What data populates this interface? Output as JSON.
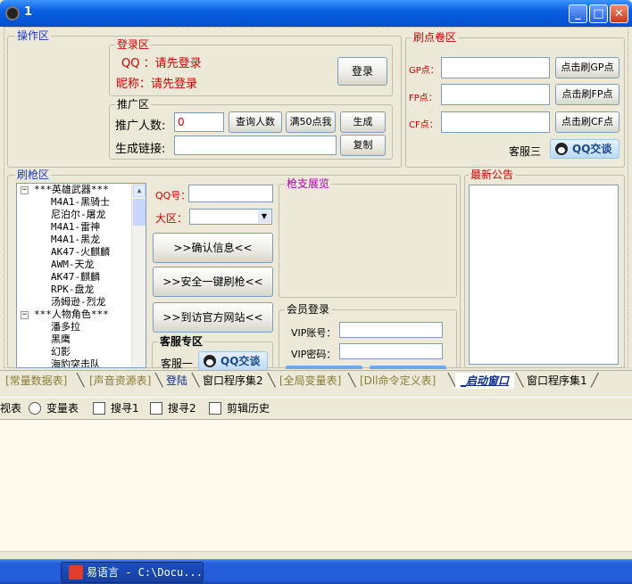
{
  "window": {
    "title": "1"
  },
  "ops": {
    "legend": "操作区"
  },
  "login": {
    "legend": "登录区",
    "qq_label": "QQ ：请先登录",
    "nick_label": "昵称：请先登录",
    "login_btn": "登录"
  },
  "promo": {
    "legend": "推广区",
    "count_label": "推广人数:",
    "count_value": "0",
    "query_btn": "查询人数",
    "full50_btn": "满50点我",
    "generate_btn": "生成",
    "link_label": "生成链接:",
    "link_value": "",
    "copy_btn": "复制"
  },
  "points": {
    "legend": "刷点卷区",
    "gp_label": "GP点：",
    "fp_label": "FP点：",
    "cf_label": "CF点：",
    "gp_btn": "点击刷GP点",
    "fp_btn": "点击刷FP点",
    "cf_btn": "点击刷CF点",
    "service_label": "客服三",
    "qq_btn": "QQ交谈"
  },
  "guns": {
    "legend": "刷枪区",
    "qq_label": "QQ号：",
    "qq_value": "",
    "region_label": "大区：",
    "region_value": "",
    "confirm_btn": ">>确认信息<<",
    "safe_btn": ">>安全一键刷枪<<",
    "official_btn": ">>到访官方网站<<",
    "service_legend": "客服专区",
    "service_label": "客服一",
    "qq_btn": "QQ交谈"
  },
  "tree": {
    "items": [
      {
        "type": "root",
        "label": "***英雄武器***"
      },
      {
        "type": "leaf",
        "label": "M4A1-黑骑士"
      },
      {
        "type": "leaf",
        "label": "尼泊尔-屠龙"
      },
      {
        "type": "leaf",
        "label": "M4A1-雷神"
      },
      {
        "type": "leaf",
        "label": "M4A1-黑龙"
      },
      {
        "type": "leaf",
        "label": "AK47-火麒麟"
      },
      {
        "type": "leaf",
        "label": "AWM-天龙"
      },
      {
        "type": "leaf",
        "label": "AK47-麒麟"
      },
      {
        "type": "leaf",
        "label": "RPK-盘龙"
      },
      {
        "type": "leaf",
        "label": "汤姆逊-烈龙"
      },
      {
        "type": "root",
        "label": "***人物角色***"
      },
      {
        "type": "leaf",
        "label": "潘多拉"
      },
      {
        "type": "leaf",
        "label": "黑鹰"
      },
      {
        "type": "leaf",
        "label": "幻影"
      },
      {
        "type": "leaf",
        "label": "海豹突击队"
      }
    ]
  },
  "preview": {
    "legend": "枪支展览"
  },
  "member": {
    "legend": "会员登录",
    "vip_account_label": "VIP账号：",
    "vip_account_value": "",
    "vip_password_label": "VIP密码：",
    "vip_password_value": ""
  },
  "notice": {
    "legend": "最新公告"
  },
  "tabs": [
    "[常量数据表]",
    "[声音资源表]",
    "登陆",
    "窗口程序集2",
    "[全局变量表]",
    "[Dll命令定义表]",
    "_启动窗口",
    "窗口程序集1"
  ],
  "active_tab": "_启动窗口",
  "toolbar": {
    "items": [
      "视表",
      "变量表",
      "搜寻1",
      "搜寻2",
      "剪辑历史"
    ]
  },
  "taskbar": {
    "task_label": "易语言 - C:\\Docu..."
  },
  "colors": {
    "title_blue": "#0553d6",
    "legend_blue": "#1d3bc8",
    "legend_red": "#d40000"
  }
}
